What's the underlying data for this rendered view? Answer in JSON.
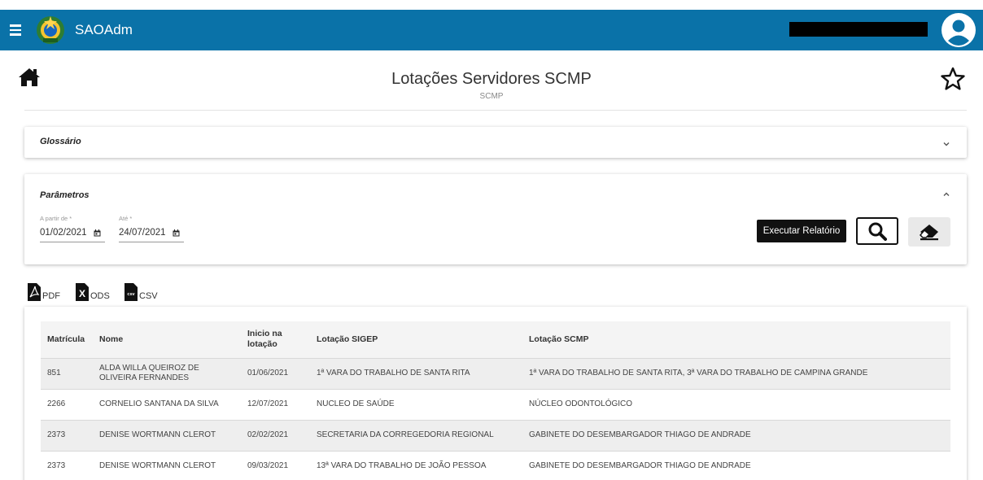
{
  "colors": {
    "topbar": "#0a72a8",
    "title": "#333333",
    "button_dark": "#111111"
  },
  "app": {
    "title": "SAOAdm"
  },
  "header": {
    "title": "Lotações Servidores SCMP",
    "subtitle": "SCMP"
  },
  "glossary": {
    "title": "Glossário"
  },
  "params": {
    "title": "Parâmetros",
    "from_label": "A partir de *",
    "from_value": "01/02/2021",
    "to_label": "Até *",
    "to_value": "24/07/2021",
    "run_label": "Executar Relatório"
  },
  "export": {
    "pdf": "PDF",
    "ods": "ODS",
    "csv": "CSV"
  },
  "table": {
    "headers": {
      "matricula": "Matrícula",
      "nome": "Nome",
      "inicio_1": "Inicio na",
      "inicio_2": "lotação",
      "sigep": "Lotação SIGEP",
      "scmp": "Lotação SCMP"
    },
    "rows": [
      {
        "matricula": "851",
        "nome_1": "ALDA WILLA QUEIROZ DE",
        "nome_2": "OLIVEIRA FERNANDES",
        "inicio": "01/06/2021",
        "sigep": "1ª VARA DO TRABALHO DE SANTA RITA",
        "scmp": "1ª VARA DO TRABALHO DE SANTA RITA, 3ª VARA DO TRABALHO DE CAMPINA GRANDE"
      },
      {
        "matricula": "2266",
        "nome_1": "CORNELIO SANTANA DA SILVA",
        "nome_2": "",
        "inicio": "12/07/2021",
        "sigep": "NUCLEO DE SAÚDE",
        "scmp": "NÚCLEO ODONTOLÓGICO"
      },
      {
        "matricula": "2373",
        "nome_1": "DENISE WORTMANN CLEROT",
        "nome_2": "",
        "inicio": "02/02/2021",
        "sigep": "SECRETARIA DA CORREGEDORIA REGIONAL",
        "scmp": "GABINETE DO DESEMBARGADOR THIAGO DE ANDRADE"
      },
      {
        "matricula": "2373",
        "nome_1": "DENISE WORTMANN CLEROT",
        "nome_2": "",
        "inicio": "09/03/2021",
        "sigep": "13ª VARA DO TRABALHO DE JOÃO PESSOA",
        "scmp": "GABINETE DO DESEMBARGADOR THIAGO DE ANDRADE"
      }
    ]
  }
}
